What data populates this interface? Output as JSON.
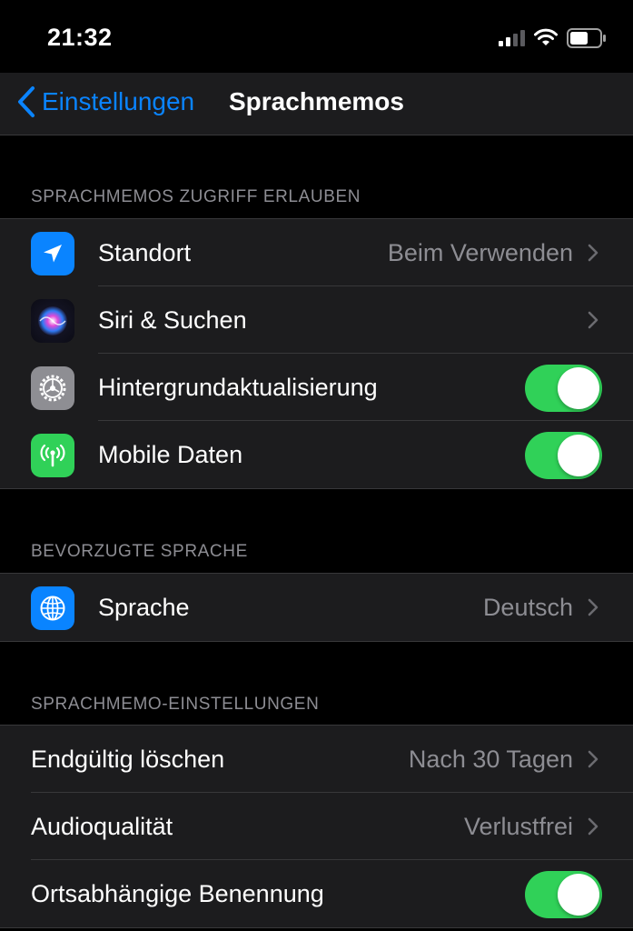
{
  "status_bar": {
    "time": "21:32"
  },
  "nav": {
    "back_label": "Einstellungen",
    "title": "Sprachmemos"
  },
  "sections": [
    {
      "header": "SPRACHMEMOS ZUGRIFF ERLAUBEN",
      "rows": [
        {
          "label": "Standort",
          "value": "Beim Verwenden",
          "icon": "location-arrow-icon",
          "accessory": "chevron"
        },
        {
          "label": "Siri & Suchen",
          "icon": "siri-icon",
          "accessory": "chevron"
        },
        {
          "label": "Hintergrundaktualisierung",
          "icon": "gear-icon",
          "accessory": "toggle",
          "toggle_on": true
        },
        {
          "label": "Mobile Daten",
          "icon": "antenna-icon",
          "accessory": "toggle",
          "toggle_on": true
        }
      ]
    },
    {
      "header": "BEVORZUGTE SPRACHE",
      "rows": [
        {
          "label": "Sprache",
          "value": "Deutsch",
          "icon": "globe-icon",
          "accessory": "chevron"
        }
      ]
    },
    {
      "header": "SPRACHMEMO-EINSTELLUNGEN",
      "rows": [
        {
          "label": "Endgültig löschen",
          "value": "Nach 30 Tagen",
          "accessory": "chevron"
        },
        {
          "label": "Audioqualität",
          "value": "Verlustfrei",
          "accessory": "chevron"
        },
        {
          "label": "Ortsabhängige Benennung",
          "accessory": "toggle",
          "toggle_on": true
        }
      ]
    }
  ],
  "colors": {
    "accent": "#0a84ff",
    "toggle_on": "#30d158",
    "cell_background": "#1c1c1e",
    "page_background": "#000000",
    "secondary_text": "#8d8d93"
  }
}
